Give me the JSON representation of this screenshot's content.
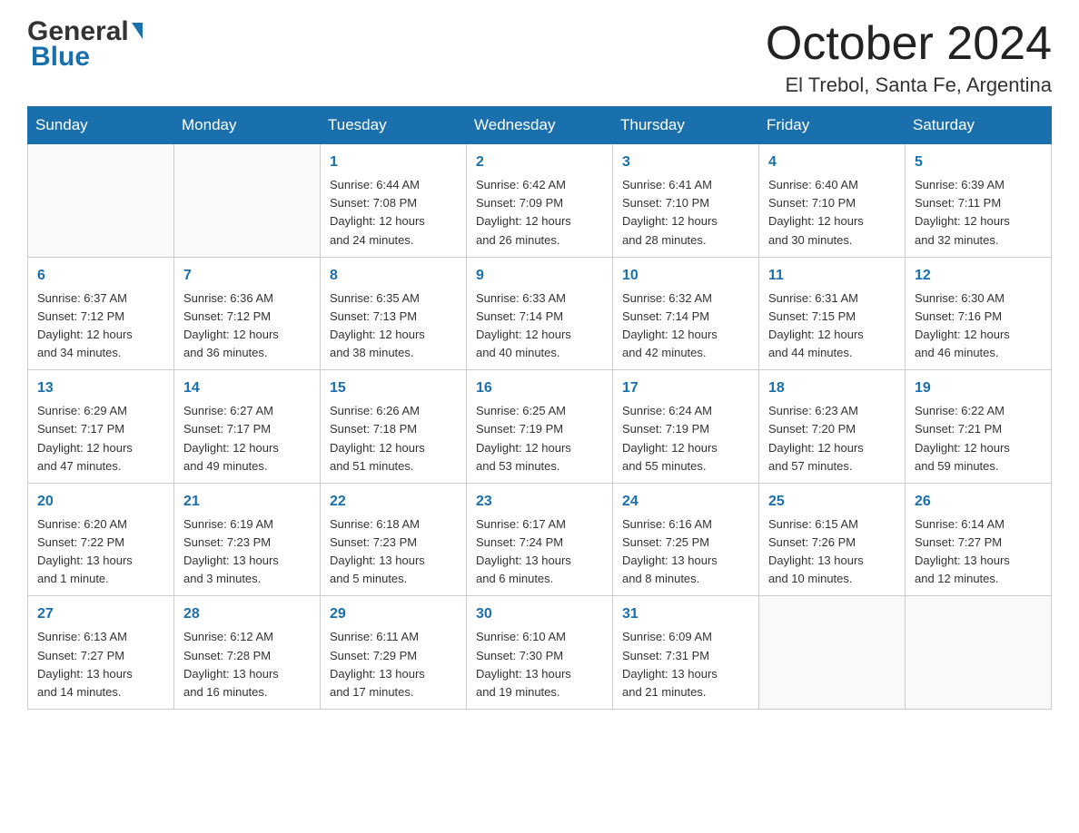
{
  "header": {
    "month_title": "October 2024",
    "location": "El Trebol, Santa Fe, Argentina"
  },
  "days_of_week": [
    "Sunday",
    "Monday",
    "Tuesday",
    "Wednesday",
    "Thursday",
    "Friday",
    "Saturday"
  ],
  "weeks": [
    [
      {
        "day": "",
        "info": ""
      },
      {
        "day": "",
        "info": ""
      },
      {
        "day": "1",
        "info": "Sunrise: 6:44 AM\nSunset: 7:08 PM\nDaylight: 12 hours\nand 24 minutes."
      },
      {
        "day": "2",
        "info": "Sunrise: 6:42 AM\nSunset: 7:09 PM\nDaylight: 12 hours\nand 26 minutes."
      },
      {
        "day": "3",
        "info": "Sunrise: 6:41 AM\nSunset: 7:10 PM\nDaylight: 12 hours\nand 28 minutes."
      },
      {
        "day": "4",
        "info": "Sunrise: 6:40 AM\nSunset: 7:10 PM\nDaylight: 12 hours\nand 30 minutes."
      },
      {
        "day": "5",
        "info": "Sunrise: 6:39 AM\nSunset: 7:11 PM\nDaylight: 12 hours\nand 32 minutes."
      }
    ],
    [
      {
        "day": "6",
        "info": "Sunrise: 6:37 AM\nSunset: 7:12 PM\nDaylight: 12 hours\nand 34 minutes."
      },
      {
        "day": "7",
        "info": "Sunrise: 6:36 AM\nSunset: 7:12 PM\nDaylight: 12 hours\nand 36 minutes."
      },
      {
        "day": "8",
        "info": "Sunrise: 6:35 AM\nSunset: 7:13 PM\nDaylight: 12 hours\nand 38 minutes."
      },
      {
        "day": "9",
        "info": "Sunrise: 6:33 AM\nSunset: 7:14 PM\nDaylight: 12 hours\nand 40 minutes."
      },
      {
        "day": "10",
        "info": "Sunrise: 6:32 AM\nSunset: 7:14 PM\nDaylight: 12 hours\nand 42 minutes."
      },
      {
        "day": "11",
        "info": "Sunrise: 6:31 AM\nSunset: 7:15 PM\nDaylight: 12 hours\nand 44 minutes."
      },
      {
        "day": "12",
        "info": "Sunrise: 6:30 AM\nSunset: 7:16 PM\nDaylight: 12 hours\nand 46 minutes."
      }
    ],
    [
      {
        "day": "13",
        "info": "Sunrise: 6:29 AM\nSunset: 7:17 PM\nDaylight: 12 hours\nand 47 minutes."
      },
      {
        "day": "14",
        "info": "Sunrise: 6:27 AM\nSunset: 7:17 PM\nDaylight: 12 hours\nand 49 minutes."
      },
      {
        "day": "15",
        "info": "Sunrise: 6:26 AM\nSunset: 7:18 PM\nDaylight: 12 hours\nand 51 minutes."
      },
      {
        "day": "16",
        "info": "Sunrise: 6:25 AM\nSunset: 7:19 PM\nDaylight: 12 hours\nand 53 minutes."
      },
      {
        "day": "17",
        "info": "Sunrise: 6:24 AM\nSunset: 7:19 PM\nDaylight: 12 hours\nand 55 minutes."
      },
      {
        "day": "18",
        "info": "Sunrise: 6:23 AM\nSunset: 7:20 PM\nDaylight: 12 hours\nand 57 minutes."
      },
      {
        "day": "19",
        "info": "Sunrise: 6:22 AM\nSunset: 7:21 PM\nDaylight: 12 hours\nand 59 minutes."
      }
    ],
    [
      {
        "day": "20",
        "info": "Sunrise: 6:20 AM\nSunset: 7:22 PM\nDaylight: 13 hours\nand 1 minute."
      },
      {
        "day": "21",
        "info": "Sunrise: 6:19 AM\nSunset: 7:23 PM\nDaylight: 13 hours\nand 3 minutes."
      },
      {
        "day": "22",
        "info": "Sunrise: 6:18 AM\nSunset: 7:23 PM\nDaylight: 13 hours\nand 5 minutes."
      },
      {
        "day": "23",
        "info": "Sunrise: 6:17 AM\nSunset: 7:24 PM\nDaylight: 13 hours\nand 6 minutes."
      },
      {
        "day": "24",
        "info": "Sunrise: 6:16 AM\nSunset: 7:25 PM\nDaylight: 13 hours\nand 8 minutes."
      },
      {
        "day": "25",
        "info": "Sunrise: 6:15 AM\nSunset: 7:26 PM\nDaylight: 13 hours\nand 10 minutes."
      },
      {
        "day": "26",
        "info": "Sunrise: 6:14 AM\nSunset: 7:27 PM\nDaylight: 13 hours\nand 12 minutes."
      }
    ],
    [
      {
        "day": "27",
        "info": "Sunrise: 6:13 AM\nSunset: 7:27 PM\nDaylight: 13 hours\nand 14 minutes."
      },
      {
        "day": "28",
        "info": "Sunrise: 6:12 AM\nSunset: 7:28 PM\nDaylight: 13 hours\nand 16 minutes."
      },
      {
        "day": "29",
        "info": "Sunrise: 6:11 AM\nSunset: 7:29 PM\nDaylight: 13 hours\nand 17 minutes."
      },
      {
        "day": "30",
        "info": "Sunrise: 6:10 AM\nSunset: 7:30 PM\nDaylight: 13 hours\nand 19 minutes."
      },
      {
        "day": "31",
        "info": "Sunrise: 6:09 AM\nSunset: 7:31 PM\nDaylight: 13 hours\nand 21 minutes."
      },
      {
        "day": "",
        "info": ""
      },
      {
        "day": "",
        "info": ""
      }
    ]
  ],
  "logo": {
    "general": "General",
    "blue": "Blue"
  }
}
